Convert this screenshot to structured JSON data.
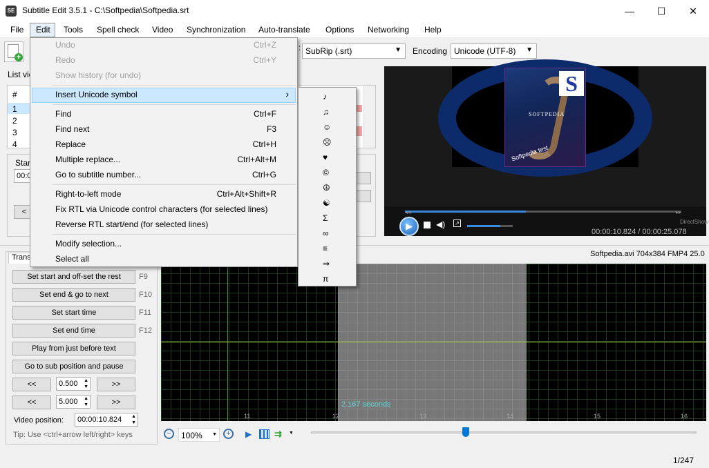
{
  "window": {
    "title": "Subtitle Edit 3.5.1 - C:\\Softpedia\\Softpedia.srt",
    "app_icon_text": "SE",
    "minimize": "—",
    "maximize": "☐",
    "close": "✕"
  },
  "menubar": [
    "File",
    "Edit",
    "Tools",
    "Spell check",
    "Video",
    "Synchronization",
    "Auto-translate",
    "Options",
    "Networking",
    "Help"
  ],
  "toolbar": {
    "format_value": "SubRip (.srt)",
    "encoding_label": "Encoding",
    "encoding_value": "Unicode (UTF-8)"
  },
  "list_view": {
    "label": "List vie",
    "header_num": "#",
    "rows": [
      "1",
      "2",
      "3",
      "4"
    ]
  },
  "edit_panel": {
    "start_label": "Star",
    "start_value": "00:0",
    "prev_btn": "<"
  },
  "edit_menu": {
    "items": [
      {
        "label": "Undo",
        "shortcut": "Ctrl+Z",
        "disabled": true
      },
      {
        "label": "Redo",
        "shortcut": "Ctrl+Y",
        "disabled": true
      },
      {
        "label": "Show history (for undo)",
        "shortcut": "",
        "disabled": true
      },
      {
        "label": "Insert Unicode symbol",
        "shortcut": "",
        "disabled": false
      },
      {
        "label": "Find",
        "shortcut": "Ctrl+F",
        "disabled": false
      },
      {
        "label": "Find next",
        "shortcut": "F3",
        "disabled": false
      },
      {
        "label": "Replace",
        "shortcut": "Ctrl+H",
        "disabled": false
      },
      {
        "label": "Multiple replace...",
        "shortcut": "Ctrl+Alt+M",
        "disabled": false
      },
      {
        "label": "Go to subtitle number...",
        "shortcut": "Ctrl+G",
        "disabled": false
      },
      {
        "label": "Right-to-left mode",
        "shortcut": "Ctrl+Alt+Shift+R",
        "disabled": false
      },
      {
        "label": "Fix RTL via Unicode control characters (for selected lines)",
        "shortcut": "",
        "disabled": false
      },
      {
        "label": "Reverse RTL start/end (for selected lines)",
        "shortcut": "",
        "disabled": false
      },
      {
        "label": "Modify selection...",
        "shortcut": "",
        "disabled": false
      },
      {
        "label": "Select all",
        "shortcut": "",
        "disabled": false
      }
    ],
    "submenu_arrow": "›"
  },
  "unicode_symbols": [
    "♪",
    "♫",
    "☺",
    "☹",
    "♥",
    "©",
    "☮",
    "☯",
    "Σ",
    "∞",
    "≡",
    "⇒",
    "π"
  ],
  "video": {
    "time_display": "00:00:10.824 / 00:00:25.078",
    "directshow_label": "DirectShow",
    "file_info": "Softpedia.avi 704x384 FMP4 25.0",
    "poster_letter": "S",
    "poster_brand": "SOFTPEDIA",
    "poster_caption": "Softpedia test"
  },
  "translate_panel": {
    "tab_label": "Trans",
    "buttons": [
      {
        "label": "Set start and off-set the rest",
        "key": "F9"
      },
      {
        "label": "Set end & go to next",
        "key": "F10"
      },
      {
        "label": "Set start time",
        "key": "F11"
      },
      {
        "label": "Set end time",
        "key": "F12"
      },
      {
        "label": "Play from just before text",
        "key": ""
      },
      {
        "label": "Go to sub position and pause",
        "key": ""
      }
    ],
    "back_btn": "<<",
    "fwd_btn": ">>",
    "step1": "0.500",
    "step2": "5.000",
    "video_position_label": "Video position:",
    "video_position_value": "00:00:10.824",
    "tip": "Tip: Use <ctrl+arrow left/right> keys"
  },
  "waveform": {
    "selection_label": "2.167 seconds",
    "ticks": [
      "11",
      "12",
      "13",
      "14",
      "15",
      "16"
    ]
  },
  "wave_toolbar": {
    "zoom_value": "100%"
  },
  "status": {
    "line_count": "1/247"
  },
  "colors": {
    "menu_highlight": "#cce8ff",
    "waveform_bg": "#000000",
    "selection_fill": "#808080",
    "green_line": "#9acd32",
    "accent_blue": "#0078d7"
  }
}
